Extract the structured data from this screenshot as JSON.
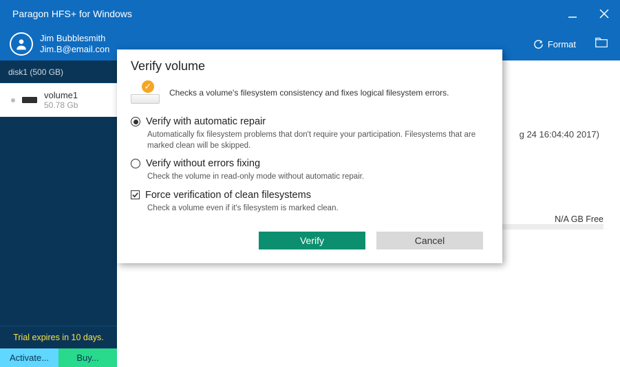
{
  "titlebar": {
    "title": "Paragon HFS+ for Windows"
  },
  "user": {
    "name": "Jim Bubblesmith",
    "email": "Jim.B@email.con"
  },
  "header": {
    "format_label": "Format"
  },
  "sidebar": {
    "disk_label": "disk1 (500 GB)",
    "volume": {
      "name": "volume1",
      "size": "50.78 Gb"
    },
    "trial_text": "Trial expires in 10 days.",
    "activate_label": "Activate...",
    "buy_label": "Buy..."
  },
  "main": {
    "timestamp_fragment": "g 24 16:04:40 2017)",
    "free_space": "N/A GB Free"
  },
  "modal": {
    "title": "Verify volume",
    "description": "Checks a volume's filesystem consistency and fixes logical filesystem errors.",
    "option1": {
      "label": "Verify with automatic repair",
      "sub": "Automatically fix filesystem problems that don't require your participation. Filesystems that are marked clean will be skipped."
    },
    "option2": {
      "label": "Verify without errors fixing",
      "sub": "Check the volume in read-only mode without automatic repair."
    },
    "option3": {
      "label": "Force verification of clean filesystems",
      "sub": "Check a volume even if it's filesystem is marked clean."
    },
    "verify_label": "Verify",
    "cancel_label": "Cancel"
  }
}
